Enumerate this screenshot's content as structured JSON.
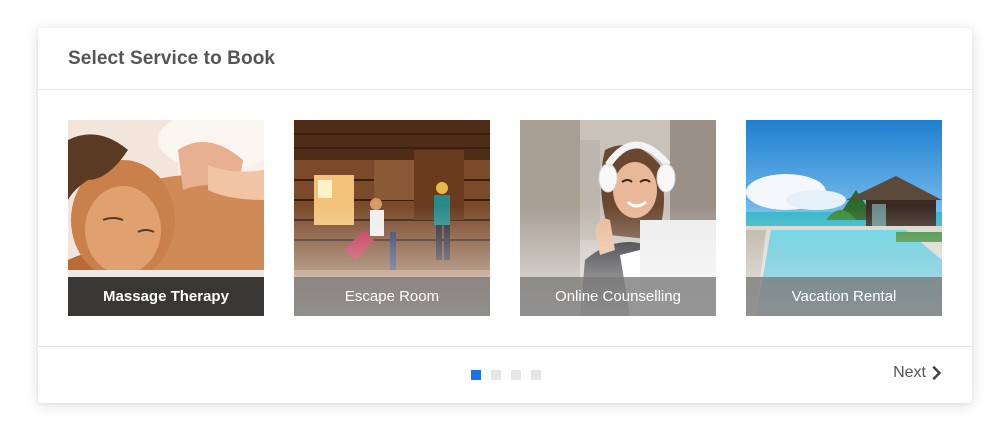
{
  "header": {
    "title": "Select Service to Book"
  },
  "services": [
    {
      "label": "Massage Therapy",
      "image": "woman-receiving-massage",
      "active": true
    },
    {
      "label": "Escape Room",
      "image": "people-in-wooden-escape-room",
      "active": false
    },
    {
      "label": "Online Counselling",
      "image": "woman-with-headphones-waving-at-laptop",
      "active": false
    },
    {
      "label": "Vacation Rental",
      "image": "tropical-villa-with-pool",
      "active": false
    }
  ],
  "pagination": {
    "pages": 4,
    "current": 1
  },
  "footer": {
    "next_label": "Next",
    "next_icon": "chevron-right-icon"
  },
  "colors": {
    "accent": "#1a73e8",
    "dot_inactive": "#e6e6e6",
    "title": "#555555"
  }
}
